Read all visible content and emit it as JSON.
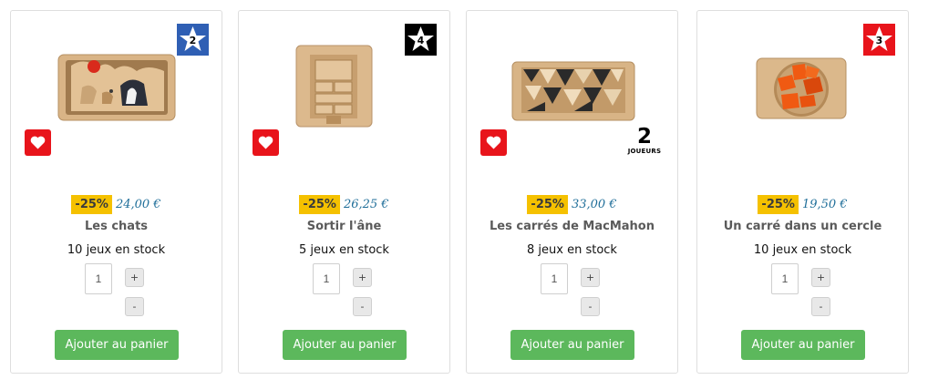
{
  "colors": {
    "discount_bg": "#f5c100",
    "price_text": "#1f6e99",
    "favorite_bg": "#e8141b",
    "add_button_bg": "#5cb85c",
    "difficulty_blue": "#2f5fb4",
    "difficulty_black": "#000000",
    "difficulty_red": "#e8141b"
  },
  "products": [
    {
      "name": "Les chats",
      "discount": "-25%",
      "price": "24,00 €",
      "stock": "10 jeux en stock",
      "quantity": "1",
      "difficulty": "2",
      "difficulty_color": "blue",
      "image_icon": "wooden-cat-puzzle-image",
      "players": null,
      "plus_label": "+",
      "minus_label": "-",
      "add_label": "Ajouter au panier"
    },
    {
      "name": "Sortir l'âne",
      "discount": "-25%",
      "price": "26,25 €",
      "stock": "5 jeux en stock",
      "quantity": "1",
      "difficulty": "4",
      "difficulty_color": "black",
      "image_icon": "wooden-sliding-block-puzzle-image",
      "players": null,
      "plus_label": "+",
      "minus_label": "-",
      "add_label": "Ajouter au panier"
    },
    {
      "name": "Les carrés de MacMahon",
      "discount": "-25%",
      "price": "33,00 €",
      "stock": "8 jeux en stock",
      "quantity": "1",
      "difficulty": null,
      "difficulty_color": null,
      "image_icon": "triangle-tiles-puzzle-image",
      "players": {
        "count": "2",
        "label": "JOUEURS"
      },
      "plus_label": "+",
      "minus_label": "-",
      "add_label": "Ajouter au panier"
    },
    {
      "name": "Un carré dans un cercle",
      "discount": "-25%",
      "price": "19,50 €",
      "stock": "10 jeux en stock",
      "quantity": "1",
      "difficulty": "3",
      "difficulty_color": "red",
      "image_icon": "square-in-circle-puzzle-image",
      "players": null,
      "plus_label": "+",
      "minus_label": "-",
      "add_label": "Ajouter au panier"
    }
  ]
}
